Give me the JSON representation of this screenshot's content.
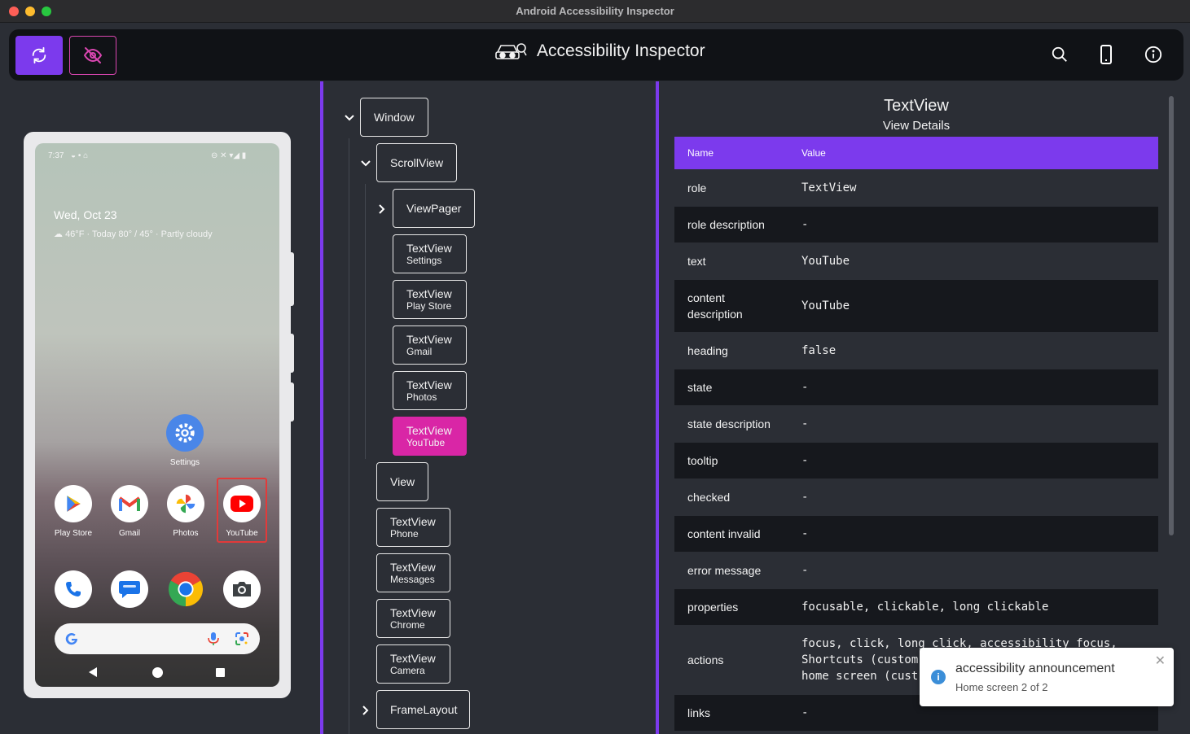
{
  "window": {
    "title": "Android Accessibility Inspector"
  },
  "toolbar": {
    "app_title": "Accessibility Inspector",
    "icons": [
      "refresh-icon",
      "eye-off-icon",
      "search-icon",
      "phone-icon",
      "info-icon"
    ]
  },
  "device": {
    "status_time": "7:37",
    "date": "Wed, Oct 23",
    "weather": "46°F  · Today 80° / 45° · Partly cloudy",
    "apps_row1": [
      {
        "label": "Settings"
      }
    ],
    "apps_row2": [
      {
        "label": "Play Store"
      },
      {
        "label": "Gmail"
      },
      {
        "label": "Photos"
      },
      {
        "label": "YouTube"
      }
    ],
    "dock": [
      "phone-icon",
      "messages-icon",
      "chrome-icon",
      "camera-icon"
    ]
  },
  "tree": {
    "window": "Window",
    "scrollview": "ScrollView",
    "viewpager": "ViewPager",
    "textviews_inner": [
      {
        "type": "TextView",
        "label": "Settings"
      },
      {
        "type": "TextView",
        "label": "Play Store"
      },
      {
        "type": "TextView",
        "label": "Gmail"
      },
      {
        "type": "TextView",
        "label": "Photos"
      },
      {
        "type": "TextView",
        "label": "YouTube"
      }
    ],
    "view": "View",
    "textviews_outer": [
      {
        "type": "TextView",
        "label": "Phone"
      },
      {
        "type": "TextView",
        "label": "Messages"
      },
      {
        "type": "TextView",
        "label": "Chrome"
      },
      {
        "type": "TextView",
        "label": "Camera"
      }
    ],
    "framelayout": "FrameLayout"
  },
  "details": {
    "title": "TextView",
    "subtitle": "View Details",
    "col_name": "Name",
    "col_value": "Value",
    "rows": [
      {
        "k": "role",
        "v": "TextView"
      },
      {
        "k": "role description",
        "v": "-"
      },
      {
        "k": "text",
        "v": "YouTube"
      },
      {
        "k": "content description",
        "v": "YouTube"
      },
      {
        "k": "heading",
        "v": "false"
      },
      {
        "k": "state",
        "v": "-"
      },
      {
        "k": "state description",
        "v": "-"
      },
      {
        "k": "tooltip",
        "v": "-"
      },
      {
        "k": "checked",
        "v": "-"
      },
      {
        "k": "content invalid",
        "v": "-"
      },
      {
        "k": "error message",
        "v": "-"
      },
      {
        "k": "properties",
        "v": "focusable, clickable, long clickable"
      },
      {
        "k": "actions",
        "v": "focus, click, long click, accessibility focus,\nShortcuts (custom\nhome screen (cust"
      },
      {
        "k": "links",
        "v": "-"
      }
    ]
  },
  "toast": {
    "title": "accessibility announcement",
    "message": "Home screen 2 of 2"
  }
}
